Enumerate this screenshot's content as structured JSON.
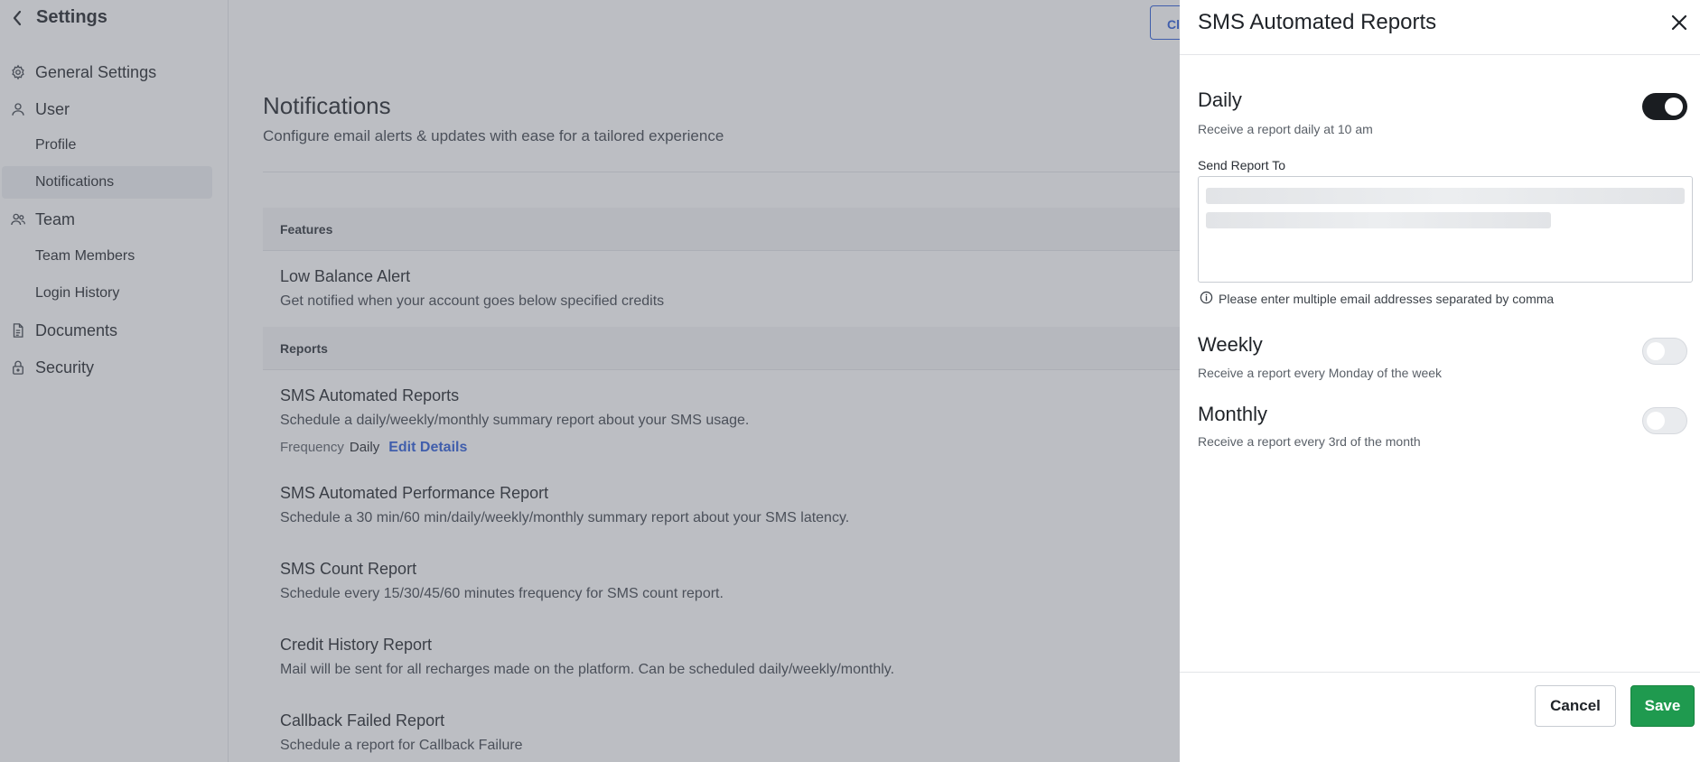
{
  "sidebar": {
    "title": "Settings",
    "items": [
      {
        "label": "General Settings",
        "icon": "gear-icon"
      },
      {
        "label": "User",
        "icon": "user-icon"
      },
      {
        "label": "Profile"
      },
      {
        "label": "Notifications",
        "active": true
      },
      {
        "label": "Team",
        "icon": "team-icon"
      },
      {
        "label": "Team Members"
      },
      {
        "label": "Login History"
      },
      {
        "label": "Documents",
        "icon": "document-icon"
      },
      {
        "label": "Security",
        "icon": "lock-icon"
      }
    ]
  },
  "main": {
    "top_button": "Cl",
    "title": "Notifications",
    "subtitle": "Configure email alerts & updates with ease for a tailored experience",
    "sections": [
      {
        "header": "Features",
        "rows": [
          {
            "title": "Low Balance Alert",
            "desc": "Get notified when your account goes below specified credits"
          }
        ]
      },
      {
        "header": "Reports",
        "rows": [
          {
            "title": "SMS Automated Reports",
            "desc": "Schedule a daily/weekly/monthly summary report about your SMS usage.",
            "frequency_label": "Frequency",
            "frequency_value": "Daily",
            "edit_label": "Edit Details"
          },
          {
            "title": "SMS Automated Performance Report",
            "desc": "Schedule a 30 min/60 min/daily/weekly/monthly summary report about your SMS latency."
          },
          {
            "title": "SMS Count Report",
            "desc": "Schedule every 15/30/45/60 minutes frequency for SMS count report."
          },
          {
            "title": "Credit History Report",
            "desc": "Mail will be sent for all recharges made on the platform. Can be scheduled daily/weekly/monthly."
          },
          {
            "title": "Callback Failed Report",
            "desc": "Schedule a report for Callback Failure"
          }
        ]
      }
    ]
  },
  "drawer": {
    "title": "SMS Automated Reports",
    "daily": {
      "title": "Daily",
      "desc": "Receive a report daily at 10 am",
      "enabled": true
    },
    "send_report_to_label": "Send Report To",
    "email_value": "",
    "hint": "Please enter multiple email addresses separated by comma",
    "weekly": {
      "title": "Weekly",
      "desc": "Receive a report every Monday of the week",
      "enabled": false
    },
    "monthly": {
      "title": "Monthly",
      "desc": "Receive a report every 3rd of the month",
      "enabled": false
    },
    "cancel_label": "Cancel",
    "save_label": "Save"
  },
  "colors": {
    "accent_blue": "#2a5bd7",
    "save_green": "#1f9a4f",
    "toggle_on": "#1a1d21",
    "overlay": "rgba(96,100,112,0.42)"
  }
}
